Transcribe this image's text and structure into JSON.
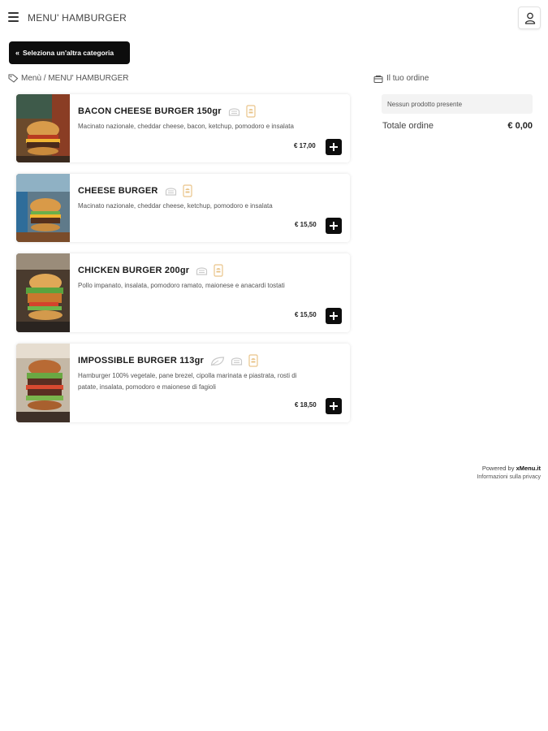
{
  "header": {
    "title": "MENU' HAMBURGER"
  },
  "nav": {
    "back_label": "Seleziona un'altra categoria",
    "breadcrumb": "Menù / MENU' HAMBURGER"
  },
  "products": [
    {
      "name": "BACON CHEESE BURGER 150gr",
      "description": "Macinato nazionale, cheddar cheese, bacon, ketchup, pomodoro e insalata",
      "price": "€ 17,00",
      "icons": [
        "bread-icon",
        "sandwich-bag-icon"
      ]
    },
    {
      "name": "CHEESE BURGER",
      "description": "Macinato nazionale, cheddar cheese, ketchup, pomodoro e insalata",
      "price": "€ 15,50",
      "icons": [
        "bread-icon",
        "sandwich-bag-icon"
      ]
    },
    {
      "name": "CHICKEN BURGER 200gr",
      "description": "Pollo impanato, insalata, pomodoro ramato, maionese e anacardi tostati",
      "price": "€ 15,50",
      "icons": [
        "bread-icon",
        "sandwich-bag-icon"
      ]
    },
    {
      "name": "IMPOSSIBLE BURGER 113gr",
      "description": "Hamburger 100% vegetale, pane brezel, cipolla marinata e piastrata, rosti di patate, insalata, pomodoro e maionese di fagioli",
      "price": "€ 18,50",
      "icons": [
        "vegan-leaf-icon",
        "bread-icon",
        "sandwich-bag-icon"
      ]
    }
  ],
  "order": {
    "title": "Il tuo ordine",
    "empty_text": "Nessun prodotto presente",
    "total_label": "Totale ordine",
    "total_value": "€ 0,00"
  },
  "footer": {
    "powered_prefix": "Powered by",
    "powered_brand": "xMenu.it",
    "privacy_link": "Informazioni sulla privacy"
  },
  "colors": {
    "accent": "#0d0d0d",
    "allergen_icon": "#e9c48a",
    "muted_icon": "#c9c9c9"
  }
}
